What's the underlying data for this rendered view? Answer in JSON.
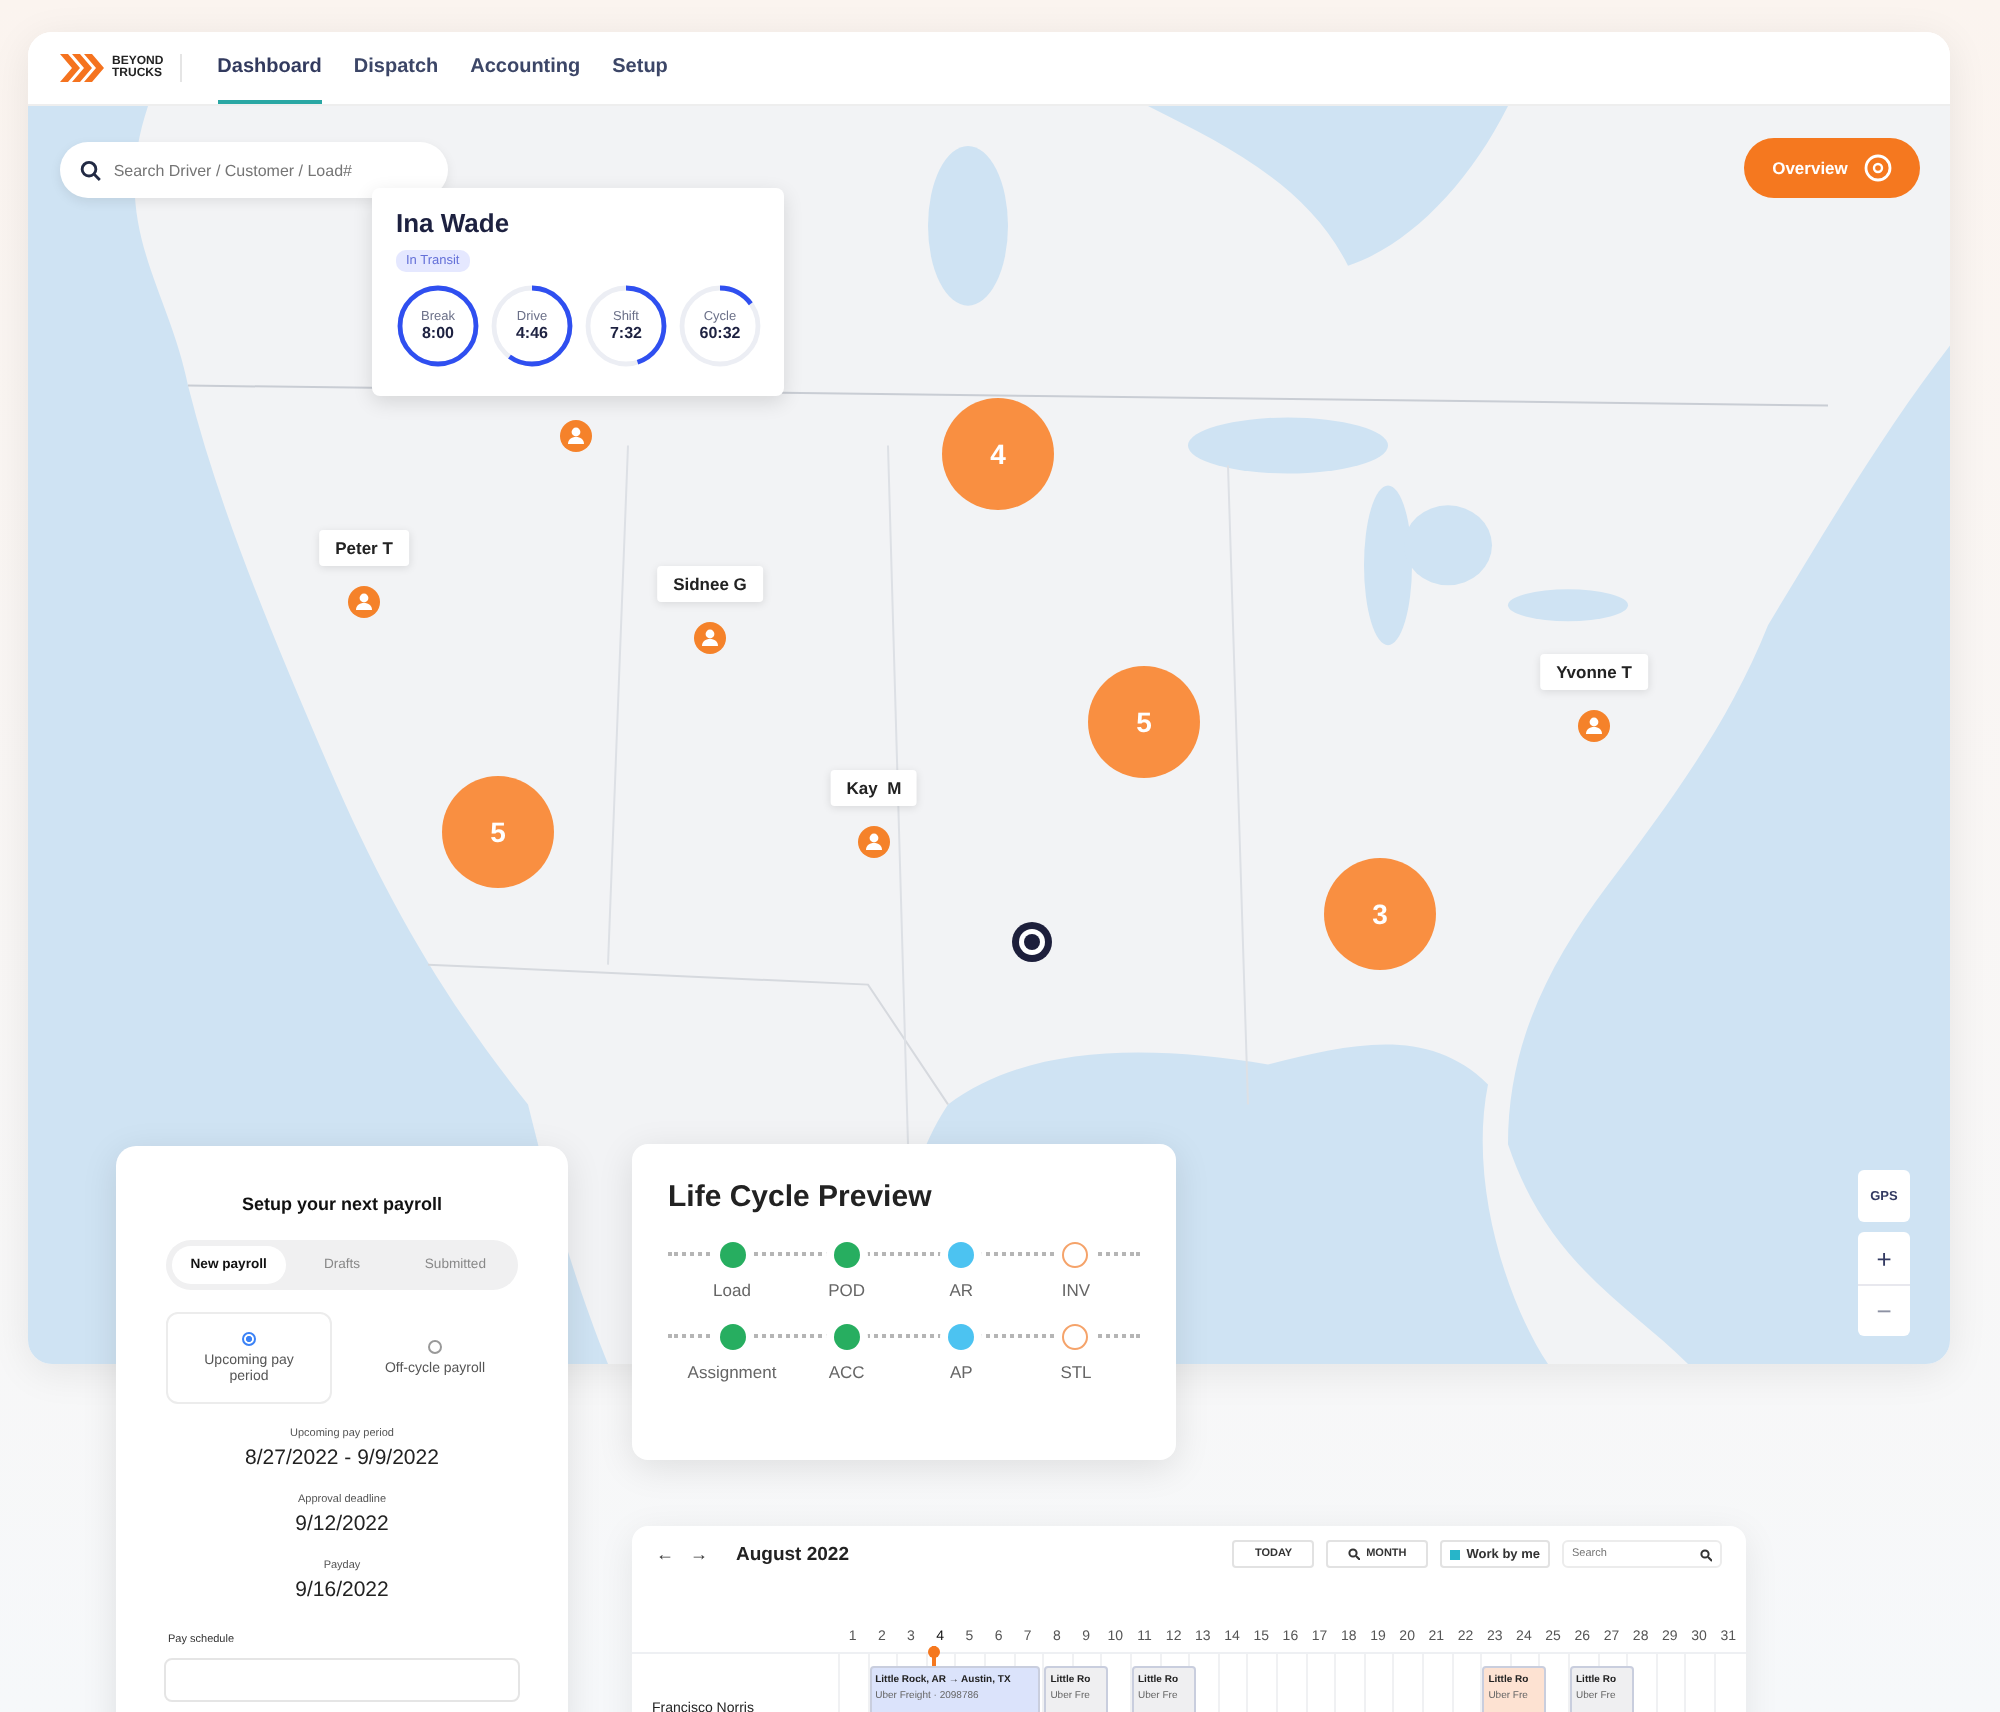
{
  "header": {
    "logo": [
      "BEYOND",
      "TRUCKS"
    ],
    "nav": [
      {
        "label": "Dashboard",
        "selected": true
      },
      {
        "label": "Dispatch",
        "selected": false
      },
      {
        "label": "Accounting",
        "selected": false
      },
      {
        "label": "Setup",
        "selected": false
      }
    ]
  },
  "map": {
    "search": {
      "placeholder": "Search Driver / Customer / Load#"
    },
    "overview_button": "Overview",
    "driver_card": {
      "name": "Ina Wade",
      "status": "In Transit",
      "timers": [
        {
          "label": "Break",
          "value": "8:00",
          "level": 1
        },
        {
          "label": "Drive",
          "value": "4:46",
          "level": 0.6
        },
        {
          "label": "Shift",
          "value": "7:32",
          "level": 0.45
        },
        {
          "label": "Cycle",
          "value": "60:32",
          "level": 0.15
        }
      ]
    },
    "pins": [
      {
        "kind": "plain"
      },
      {
        "kind": "labeled",
        "label": "Peter T"
      },
      {
        "kind": "labeled",
        "label": "Sidnee G"
      },
      {
        "kind": "labeled",
        "label": "Kay  M"
      },
      {
        "kind": "labeled",
        "label": "Yvonne T"
      }
    ],
    "clusters": [
      "4",
      "5",
      "5",
      "3"
    ],
    "controls": [
      {
        "label": "GPS",
        "disabled": false
      }
    ],
    "zoom": [
      {
        "label": "+",
        "disabled": false
      },
      {
        "label": "−",
        "disabled": true
      }
    ]
  },
  "payroll": {
    "title": "Setup your next payroll",
    "tabs": [
      {
        "label": "New payroll",
        "selected": true
      },
      {
        "label": "Drafts",
        "selected": false
      },
      {
        "label": "Submitted",
        "selected": false
      }
    ],
    "options": [
      {
        "label": "Upcoming pay period",
        "selected": true
      },
      {
        "label": "Off-cycle payroll",
        "selected": false
      }
    ],
    "fields": [
      {
        "label": "Upcoming pay period",
        "value": "8/27/2022 - 9/9/2022"
      },
      {
        "label": "Approval deadline",
        "value": "9/12/2022"
      },
      {
        "label": "Payday",
        "value": "9/16/2022"
      }
    ],
    "schedule_label": "Pay schedule"
  },
  "life_cycle": {
    "title": "Life Cycle Preview",
    "rows": [
      [
        {
          "name": "Load",
          "kind": "done"
        },
        {
          "name": "POD",
          "kind": "done"
        },
        {
          "name": "AR",
          "kind": "active"
        },
        {
          "name": "INV",
          "kind": "pending"
        }
      ],
      [
        {
          "name": "Assignment",
          "kind": "done"
        },
        {
          "name": "ACC",
          "kind": "done"
        },
        {
          "name": "AP",
          "kind": "active"
        },
        {
          "name": "STL",
          "kind": "pending"
        }
      ]
    ]
  },
  "calendar": {
    "arrows": [
      "←",
      "→"
    ],
    "month": "August 2022",
    "buttons": [
      {
        "label": "TODAY",
        "kind": "plain"
      },
      {
        "label": "MONTH",
        "kind": "icon"
      },
      {
        "label": "Work by me",
        "kind": "legend"
      }
    ],
    "search": {
      "placeholder": "Search"
    },
    "days": [
      {
        "label": "1",
        "today": false
      },
      {
        "label": "2",
        "today": false
      },
      {
        "label": "3",
        "today": false
      },
      {
        "label": "4",
        "today": true
      },
      {
        "label": "5",
        "today": false
      },
      {
        "label": "6",
        "today": false
      },
      {
        "label": "7",
        "today": false
      },
      {
        "label": "8",
        "today": false
      },
      {
        "label": "9",
        "today": false
      },
      {
        "label": "10",
        "today": false
      },
      {
        "label": "11",
        "today": false
      },
      {
        "label": "12",
        "today": false
      },
      {
        "label": "13",
        "today": false
      },
      {
        "label": "14",
        "today": false
      },
      {
        "label": "15",
        "today": false
      },
      {
        "label": "16",
        "today": false
      },
      {
        "label": "17",
        "today": false
      },
      {
        "label": "18",
        "today": false
      },
      {
        "label": "19",
        "today": false
      },
      {
        "label": "20",
        "today": false
      },
      {
        "label": "21",
        "today": false
      },
      {
        "label": "22",
        "today": false
      },
      {
        "label": "23",
        "today": false
      },
      {
        "label": "24",
        "today": false
      },
      {
        "label": "25",
        "today": false
      },
      {
        "label": "26",
        "today": false
      },
      {
        "label": "27",
        "today": false
      },
      {
        "label": "28",
        "today": false
      },
      {
        "label": "29",
        "today": false
      },
      {
        "label": "30",
        "today": false
      },
      {
        "label": "31",
        "today": false
      }
    ],
    "rows": [
      {
        "name": "Francisco Norris",
        "events": [
          {
            "title": "Little Rock, AR → Austin, TX",
            "subtitle": "Uber Freight · 2098786",
            "color": "#dbe3fb"
          },
          {
            "title": "Little Ro",
            "subtitle": "Uber Fre",
            "color": "#efeff1"
          },
          {
            "title": "Little Ro",
            "subtitle": "Uber Fre",
            "color": "#efeff1"
          },
          {
            "title": "Little Ro",
            "subtitle": "Uber Fre",
            "color": "#fde2d2"
          },
          {
            "title": "Little Ro",
            "subtitle": "Uber Fre",
            "color": "#efeff1"
          }
        ]
      }
    ]
  }
}
